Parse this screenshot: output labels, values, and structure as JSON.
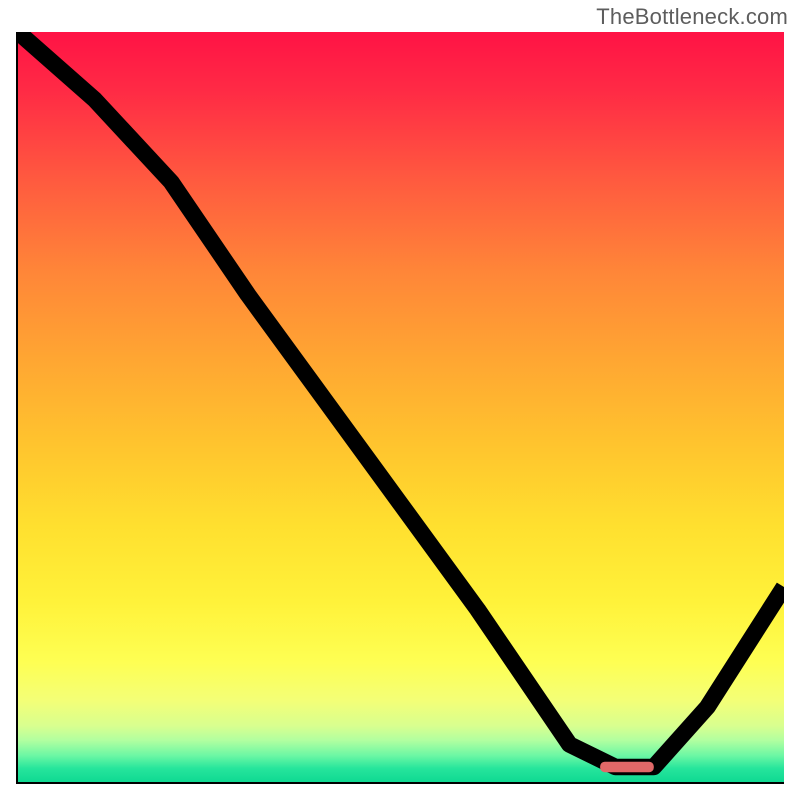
{
  "watermark": "TheBottleneck.com",
  "chart_data": {
    "type": "line",
    "title": "",
    "xlabel": "",
    "ylabel": "",
    "xlim": [
      0,
      100
    ],
    "ylim": [
      0,
      100
    ],
    "grid": false,
    "legend": false,
    "series": [
      {
        "name": "curve",
        "x": [
          0,
          10,
          20,
          30,
          40,
          50,
          60,
          72,
          78,
          83,
          90,
          100
        ],
        "y": [
          100,
          91,
          80,
          65,
          51,
          37,
          23,
          5,
          2,
          2,
          10,
          26
        ]
      }
    ],
    "marker": {
      "x_from": 76,
      "x_to": 83,
      "y": 2
    },
    "gradient_stops": [
      {
        "pos": 0,
        "color": "#ff1345"
      },
      {
        "pos": 50,
        "color": "#ffc42e"
      },
      {
        "pos": 85,
        "color": "#feff53"
      },
      {
        "pos": 100,
        "color": "#0fd992"
      }
    ]
  }
}
